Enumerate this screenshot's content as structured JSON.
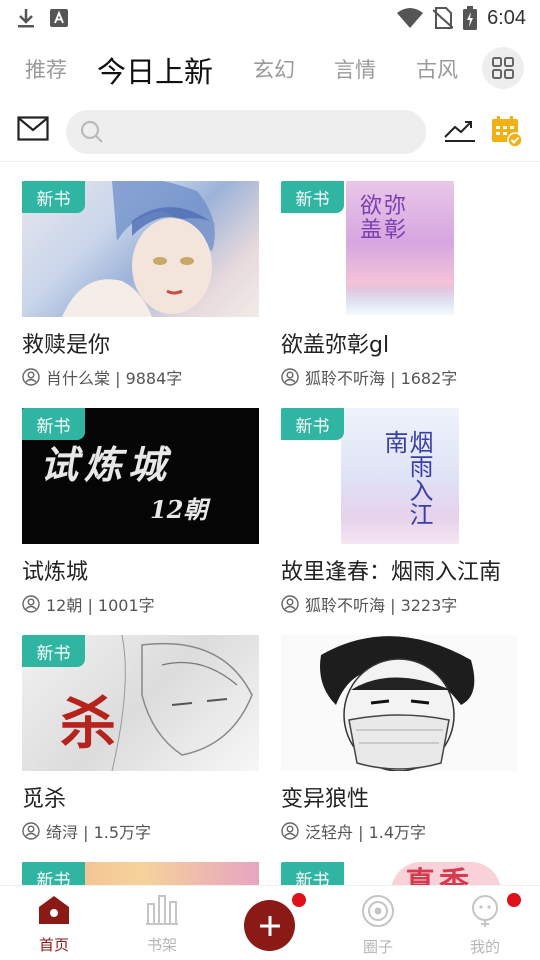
{
  "status_bar": {
    "time": "6:04"
  },
  "tabs": [
    {
      "label": "推荐",
      "active": false
    },
    {
      "label": "今日上新",
      "active": true
    },
    {
      "label": "玄幻",
      "active": false
    },
    {
      "label": "言情",
      "active": false
    },
    {
      "label": "古风",
      "active": false
    }
  ],
  "search": {
    "placeholder": "",
    "value": ""
  },
  "badge_label": "新书",
  "books": [
    {
      "title": "救赎是你",
      "author": "肖什么棠",
      "words": "9884字",
      "meta": "肖什么棠 | 9884字"
    },
    {
      "title": "欲盖弥彰gl",
      "author": "狐聆不听海",
      "words": "1682字",
      "meta": "狐聆不听海 | 1682字",
      "cover_text": "欲弥盖彰"
    },
    {
      "title": "试炼城",
      "author": "12朝",
      "words": "1001字",
      "meta": "12朝 | 1001字",
      "cover_text_main": "试炼城",
      "cover_text_sub": "12朝"
    },
    {
      "title": "故里逢春：烟雨入江南",
      "author": "狐聆不听海",
      "words": "3223字",
      "meta": "狐聆不听海 | 3223字",
      "cover_text": "烟雨入江南"
    },
    {
      "title": "觅杀",
      "author": "绮浔",
      "words": "1.5万字",
      "meta": "绮浔 | 1.5万字",
      "cover_text": "杀"
    },
    {
      "title": "变异狼性",
      "author": "泛轻舟",
      "words": "1.4万字",
      "meta": "泛轻舟 | 1.4万字"
    }
  ],
  "partial_cover_text": "真香",
  "bottom_nav": [
    {
      "label": "首页",
      "active": true
    },
    {
      "label": "书架",
      "active": false
    },
    {
      "label": "",
      "active": false
    },
    {
      "label": "圈子",
      "active": false
    },
    {
      "label": "我的",
      "active": false
    }
  ],
  "colors": {
    "accent": "#8b1a16",
    "badge": "#2fb5a1",
    "notification": "#e0101a",
    "calendar": "#f2b015"
  }
}
